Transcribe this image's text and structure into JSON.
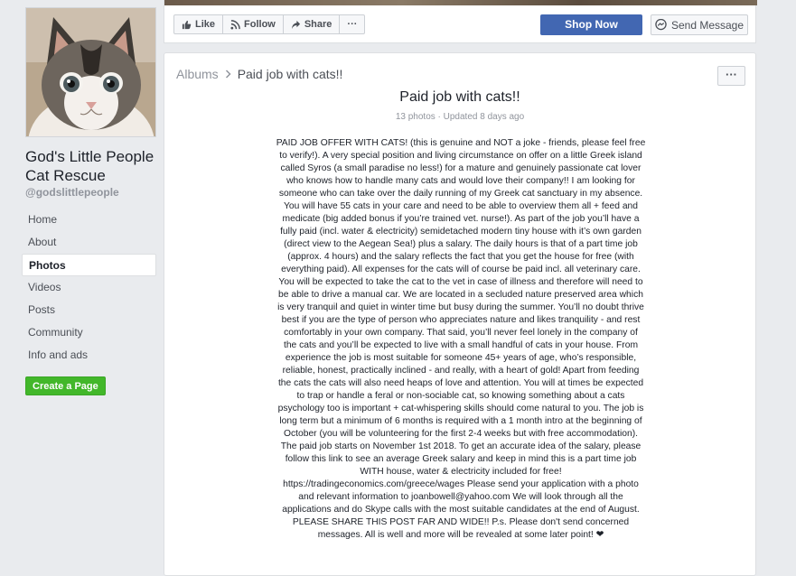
{
  "page": {
    "name": "God's Little People Cat Rescue",
    "handle": "@godslittlepeople"
  },
  "nav": {
    "items": [
      {
        "label": "Home"
      },
      {
        "label": "About"
      },
      {
        "label": "Photos"
      },
      {
        "label": "Videos"
      },
      {
        "label": "Posts"
      },
      {
        "label": "Community"
      },
      {
        "label": "Info and ads"
      }
    ],
    "active": "Photos"
  },
  "create_page": {
    "label": "Create a Page"
  },
  "actions": {
    "like": "Like",
    "follow": "Follow",
    "share": "Share",
    "more": "···",
    "shop_now": "Shop Now",
    "send_message": "Send Message"
  },
  "album": {
    "breadcrumb_root": "Albums",
    "breadcrumb_current": "Paid job with cats!!",
    "more": "···",
    "title": "Paid job with cats!!",
    "meta": "13 photos · Updated 8 days ago",
    "description": "PAID JOB OFFER WITH CATS! (this is genuine and NOT a joke - friends, please feel free\nto verify!). A very special position and living circumstance on offer on a little Greek island\ncalled Syros (a small paradise no less!) for a mature and genuinely passionate cat lover\nwho knows how to handle many cats and would love their company!! I am looking for\nsomeone who can take over the daily running of my Greek cat sanctuary in my absence.\nYou will have 55 cats in your care and need to be able to overview them all + feed and\nmedicate (big added bonus if you’re trained vet. nurse!). As part of the job you’ll have a\nfully paid (incl. water & electricity) semidetached modern tiny house with it’s own garden\n(direct view to the Aegean Sea!) plus a salary. The daily hours is that of a part time job\n(approx. 4 hours) and the salary reflects the fact that you get the house for free (with\neverything paid). All expenses for the cats will of course be paid incl. all veterinary care.\nYou will be expected to take the cat to the vet in case of illness and therefore will need to\nbe able to drive a manual car. We are located in a secluded nature preserved area which\nis very tranquil and quiet in winter time but busy during the summer. You’ll no doubt thrive\nbest if you are the type of person who appreciates nature and likes tranquility - and rest\ncomfortably in your own company. That said, you’ll never feel lonely in the company of\nthe cats and you’ll be expected to live with a small handful of cats in your house. From\nexperience the job is most suitable for someone 45+ years of age, who’s responsible,\nreliable, honest, practically inclined - and really, with a heart of gold! Apart from feeding\nthe cats the cats will also need heaps of love and attention. You will at times be expected\nto trap or handle a feral or non-sociable cat, so knowing something about a cats\npsychology too is important + cat-whispering skills should come natural to you. The job is\nlong term but a minimum of 6 months is required with a 1 month intro at the beginning of\nOctober (you will be volunteering for the first 2-4 weeks but with free accommodation).\nThe paid job starts on November 1st 2018. To get an accurate idea of the salary, please\nfollow this link to see an average Greek salary and keep in mind this is a part time job\nWITH house, water & electricity included for free!\nhttps://tradingeconomics.com/greece/wages Please send your application with a photo\nand relevant information to joanbowell@yahoo.com We will look through all the\napplications and do Skype calls with the most suitable candidates at the end of August.\nPLEASE SHARE THIS POST FAR AND WIDE!! P.s. Please don't send concerned\nmessages. All is well and more will be revealed at some later point! ❤"
  },
  "colors": {
    "background": "#e9ebee",
    "brand_blue": "#4267b2",
    "create_green": "#42b72a",
    "muted_text": "#90949c"
  },
  "icons": {
    "like": "thumbs-up-icon",
    "follow": "rss-icon",
    "share": "share-arrow-icon",
    "send_message": "messenger-icon",
    "breadcrumb_separator": "chevron-right-icon"
  }
}
